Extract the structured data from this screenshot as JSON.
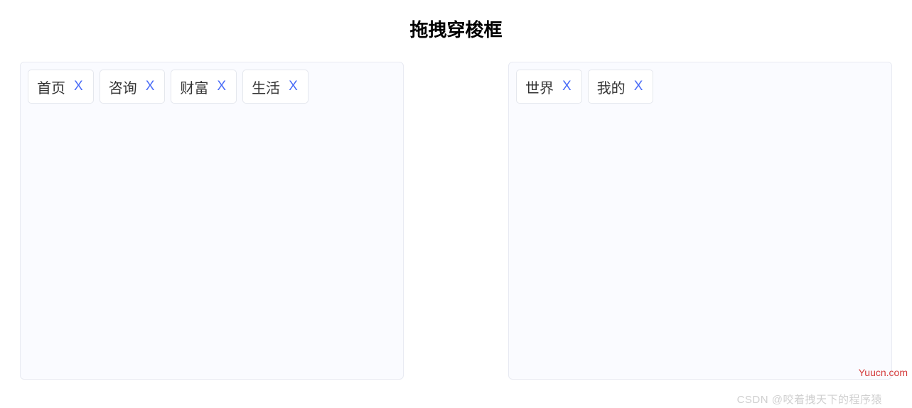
{
  "title": "拖拽穿梭框",
  "close_symbol": "X",
  "left_panel": {
    "items": [
      {
        "label": "首页"
      },
      {
        "label": "咨询"
      },
      {
        "label": "财富"
      },
      {
        "label": "生活"
      }
    ]
  },
  "right_panel": {
    "items": [
      {
        "label": "世界"
      },
      {
        "label": "我的"
      }
    ]
  },
  "watermark_author": "CSDN @咬着拽天下的程序猿",
  "watermark_site": "Yuucn.com"
}
